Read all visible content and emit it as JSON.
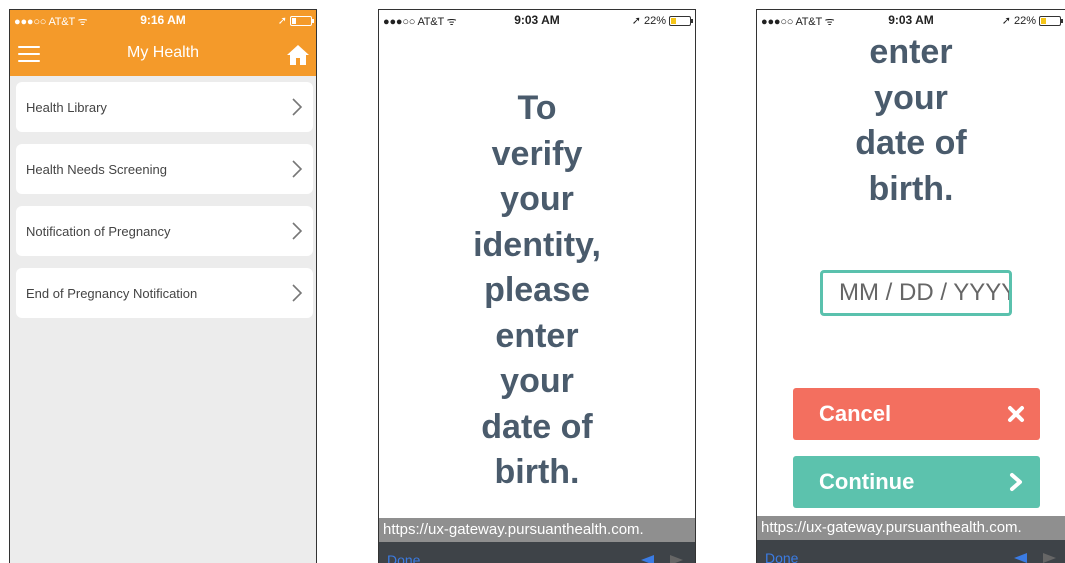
{
  "screens": {
    "my_health": {
      "status": {
        "carrier": "●●●○○ AT&T ᯤ",
        "time": "9:16 AM",
        "right_icon": "➚"
      },
      "title": "My Health",
      "menu_icon": "hamburger-icon",
      "home_icon": "home-icon",
      "items": [
        {
          "label": "Health Library"
        },
        {
          "label": "Health Needs Screening"
        },
        {
          "label": "Notification of Pregnancy"
        },
        {
          "label": "End of Pregnancy Notification"
        }
      ]
    },
    "verify_identity": {
      "status": {
        "carrier": "●●●○○ AT&T ᯤ",
        "time": "9:03 AM",
        "battery": "➚ 22%"
      },
      "message_lines": [
        "To",
        "verify",
        "your",
        "identity,",
        "please",
        "enter",
        "your",
        "date of",
        "birth."
      ],
      "url": "https://ux-gateway.pursuanthealth.com.",
      "done_label": "Done"
    },
    "date_of_birth": {
      "status": {
        "carrier": "●●●○○ AT&T ᯤ",
        "time": "9:03 AM",
        "battery": "➚ 22%"
      },
      "message_lines": [
        "enter",
        "your",
        "date of",
        "birth."
      ],
      "dob_placeholder": "MM / DD / YYYY",
      "cancel_label": "Cancel",
      "continue_label": "Continue",
      "url": "https://ux-gateway.pursuanthealth.com.",
      "done_label": "Done"
    }
  },
  "colors": {
    "brand_orange": "#f49a2a",
    "text_slate": "#4a5b6c",
    "teal": "#5cc2ad",
    "cancel_red": "#f36f5f",
    "toolbar_dark": "#3e4348",
    "url_gray": "#8f8f8f"
  }
}
